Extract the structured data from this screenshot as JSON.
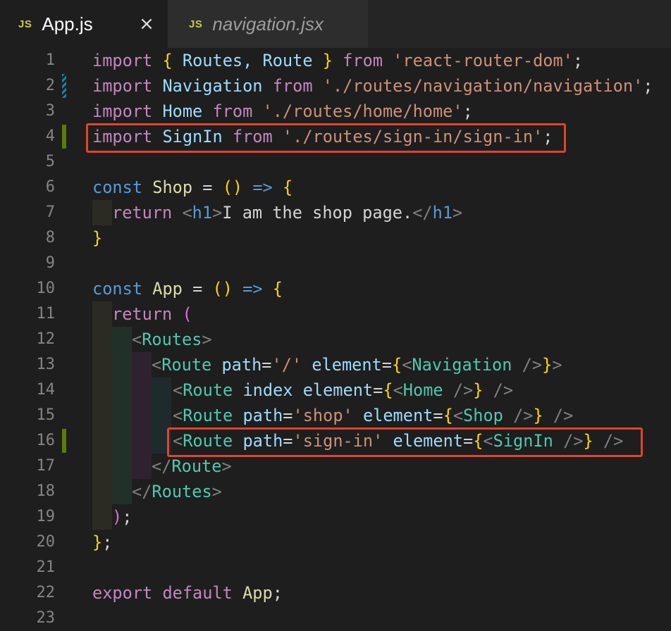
{
  "tabs": [
    {
      "badge": "JS",
      "name": "App.js",
      "active": true,
      "close_icon": "×"
    },
    {
      "badge": "JS",
      "name": "navigation.jsx",
      "active": false
    }
  ],
  "line_numbers": [
    "1",
    "2",
    "3",
    "4",
    "5",
    "6",
    "7",
    "8",
    "9",
    "10",
    "11",
    "12",
    "13",
    "14",
    "15",
    "16",
    "17",
    "18",
    "19",
    "20",
    "21",
    "22",
    "23"
  ],
  "code": {
    "l1": [
      "import",
      " ",
      "{",
      " Routes, Route ",
      "}",
      " from ",
      "'react-router-dom'",
      ";"
    ],
    "l2": [
      "import",
      " Navigation ",
      "from",
      " './routes/navigation/navigation'",
      ";"
    ],
    "l3": [
      "import",
      " Home ",
      "from",
      " './routes/home/home'",
      ";"
    ],
    "l4": [
      "import",
      " SignIn ",
      "from",
      " './routes/sign-in/sign-in'",
      ";"
    ],
    "l6": [
      "const",
      " Shop ",
      "=",
      " (",
      ")",
      " => ",
      "{"
    ],
    "l7": [
      "return",
      " <",
      "h1",
      ">",
      "I am the shop page.",
      "</",
      "h1",
      ">"
    ],
    "l8": [
      "}"
    ],
    "l10": [
      "const",
      " App ",
      "=",
      " (",
      ")",
      " => ",
      "{"
    ],
    "l11": [
      "return",
      " ",
      "("
    ],
    "l12": [
      "<",
      "Routes",
      ">"
    ],
    "l13": [
      "<",
      "Route",
      " path",
      "=",
      "'/'",
      " element",
      "=",
      "{",
      "<",
      "Navigation",
      " />",
      "}",
      ">"
    ],
    "l14": [
      "<",
      "Route",
      " index",
      " element",
      "=",
      "{",
      "<",
      "Home",
      " />",
      "}",
      " />"
    ],
    "l15": [
      "<",
      "Route",
      " path",
      "=",
      "'shop'",
      " element",
      "=",
      "{",
      "<",
      "Shop",
      " />",
      "}",
      " />"
    ],
    "l16": [
      "<",
      "Route",
      " path",
      "=",
      "'sign-in'",
      " element",
      "=",
      "{",
      "<",
      "SignIn",
      " />",
      "}",
      " />"
    ],
    "l17": [
      "</",
      "Route",
      ">"
    ],
    "l18": [
      "</",
      "Routes",
      ">"
    ],
    "l19": [
      ")",
      ";"
    ],
    "l20": [
      "}",
      ";"
    ],
    "l22": [
      "export",
      " default",
      " App",
      ";"
    ]
  },
  "colors": {
    "highlight_box": "#e0442c",
    "gutter_added": "#587c0c",
    "gutter_modified": "#1b81a8"
  }
}
